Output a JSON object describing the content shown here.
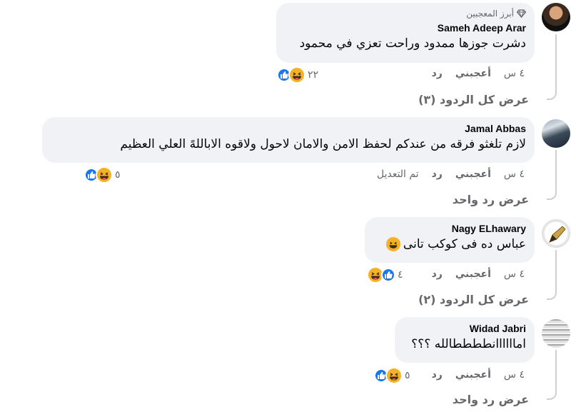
{
  "comments": [
    {
      "badge": "أبرز المعجبين",
      "author": "Sameh Adeep Arar",
      "text": "دشرت جوزها ممدود وراحت تعزي في محمود",
      "time": "٤ س",
      "like_label": "أعجبني",
      "reply_label": "رد",
      "edited_label": "",
      "reaction_count": "٢٢",
      "view_replies": "عرض كل الردود (٣)"
    },
    {
      "author": "Jamal Abbas",
      "text": "لازم تلغثو فرقه من عندكم لحفظ الامن والامان لاحول ولاقوه الاباللهً العلي العظيم",
      "time": "٤ س",
      "like_label": "أعجبني",
      "reply_label": "رد",
      "edited_label": "تم التعديل",
      "reaction_count": "٥",
      "view_replies": "عرض رد واحد"
    },
    {
      "author": "Nagy ELhawary",
      "text": "عباس ده فى كوكب تانى",
      "time": "٤ س",
      "like_label": "أعجبني",
      "reply_label": "رد",
      "edited_label": "",
      "reaction_count": "٤",
      "view_replies": "عرض كل الردود (٢)"
    },
    {
      "author": "Widad Jabri",
      "text": "اماااااانططططالله ؟؟؟",
      "time": "٤ س",
      "like_label": "أعجبني",
      "reply_label": "رد",
      "edited_label": "",
      "reaction_count": "٥",
      "view_replies": "عرض رد واحد"
    }
  ],
  "icons": {
    "like": "like-reaction-icon",
    "haha": "haha-reaction-icon",
    "badge": "diamond-badge-icon"
  },
  "colors": {
    "bubble": "#f0f2f5",
    "muted": "#65676b",
    "like_blue": "#1877f2",
    "haha_yellow": "#f7b125"
  }
}
